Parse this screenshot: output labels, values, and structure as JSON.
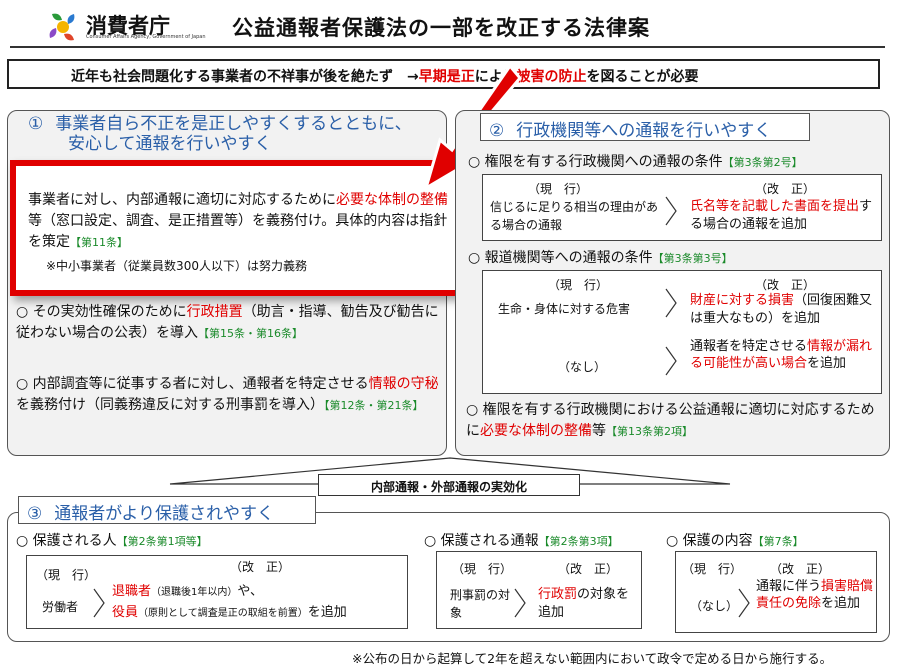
{
  "header": {
    "logo_text": "消費者庁",
    "logo_subtext": "Consumer Affairs Agency, Government of Japan",
    "title": "公益通報者保護法の一部を改正する法律案"
  },
  "banner": {
    "text_before": "近年も社会問題化する事業者の不祥事が後を絶たず　→",
    "highlight1": "早期是正",
    "text_mid": "により",
    "highlight2": "被害の防止",
    "text_after": "を図ることが必要"
  },
  "section1": {
    "num": "①",
    "title": "事業者自ら不正を是正しやすくするとともに、",
    "title2": "安心して通報を行いやすく",
    "callout": {
      "t1": "事業者に対し、内部通報に適切に対応するために",
      "r1": "必要な体制の整備",
      "t2": "等（窓口設定、調査、是正措置等）を義務付け。具体的内容は指針を策定",
      "ref": "【第11条】",
      "note": "※中小事業者（従業員数300人以下）は努力義務"
    },
    "bullet2": {
      "t1": "その実効性確保のために",
      "r1": "行政措置",
      "t2": "（助言・指導、勧告及び勧告に従わない場合の公表）を導入",
      "ref": "【第15条・第16条】"
    },
    "bullet3": {
      "t1": "内部調査等に従事する者に対し、通報者を特定させる",
      "r1": "情報の守秘",
      "t2": "を義務付け（同義務違反に対する刑事罰を導入）",
      "ref": "【第12条・第21条】"
    }
  },
  "section2": {
    "num": "②",
    "title": "行政機関等への通報を行いやすく",
    "sub1": {
      "label": "権限を有する行政機関への通報の条件",
      "ref": "【第3条第2号】",
      "current_header": "（現　行）",
      "current_text": "信じるに足りる相当の理由がある場合の通報",
      "revised_header": "（改　正）",
      "revised_red": "氏名等を記載した書面を提出",
      "revised_text": "する場合の通報を追加"
    },
    "sub2": {
      "label": "報道機関等への通報の条件",
      "ref": "【第3条第3号】",
      "current_header": "（現　行）",
      "current_text1": "生命・身体に対する危害",
      "revised_header": "（改　正）",
      "r1_red": "財産に対する損害",
      "r1_text": "（回復困難又は重大なもの）を追加",
      "current_text2": "（なし）",
      "r2_t1": "通報者を特定させる",
      "r2_red1": "情報が漏れる可能性が高い場合",
      "r2_t2": "を追加"
    },
    "bullet": {
      "t1": "権限を有する行政機関における公益通報に適切に対応するために",
      "r1": "必要な体制の整備",
      "t2": "等",
      "ref": "【第13条第2項】"
    }
  },
  "connector": "内部通報・外部通報の実効化",
  "section3": {
    "num": "③",
    "title": "通報者がより保護されやすく",
    "col1": {
      "label": "保護される人",
      "ref": "【第2条第1項等】",
      "current_header": "（現　行）",
      "revised_header": "（改　正）",
      "current_text": "労働者",
      "r1_red": "退職者",
      "r1_small": "（退職後1年以内）",
      "r1_text": "や、",
      "r2_red": "役員",
      "r2_small": "（原則として調査是正の取組を前置）",
      "r2_text": "を追加"
    },
    "col2": {
      "label": "保護される通報",
      "ref": "【第2条第3項】",
      "current_header": "（現　行）",
      "revised_header": "（改　正）",
      "current_text": "刑事罰の対象",
      "r_red": "行政罰",
      "r_text": "の対象を追加"
    },
    "col3": {
      "label": "保護の内容",
      "ref": "【第7条】",
      "current_header": "（現　行）",
      "revised_header": "（改　正）",
      "current_text": "（なし）",
      "r_t1": "通報に伴う",
      "r_red1": "損害賠償責任の免除",
      "r_text": "を追加"
    }
  },
  "footer": "※公布の日から起算して2年を超えない範囲内において政令で定める日から施行する。",
  "colors": {
    "accent_red": "#e00000",
    "title_blue": "#2a5fa8",
    "ref_green": "#1a8a2a"
  }
}
